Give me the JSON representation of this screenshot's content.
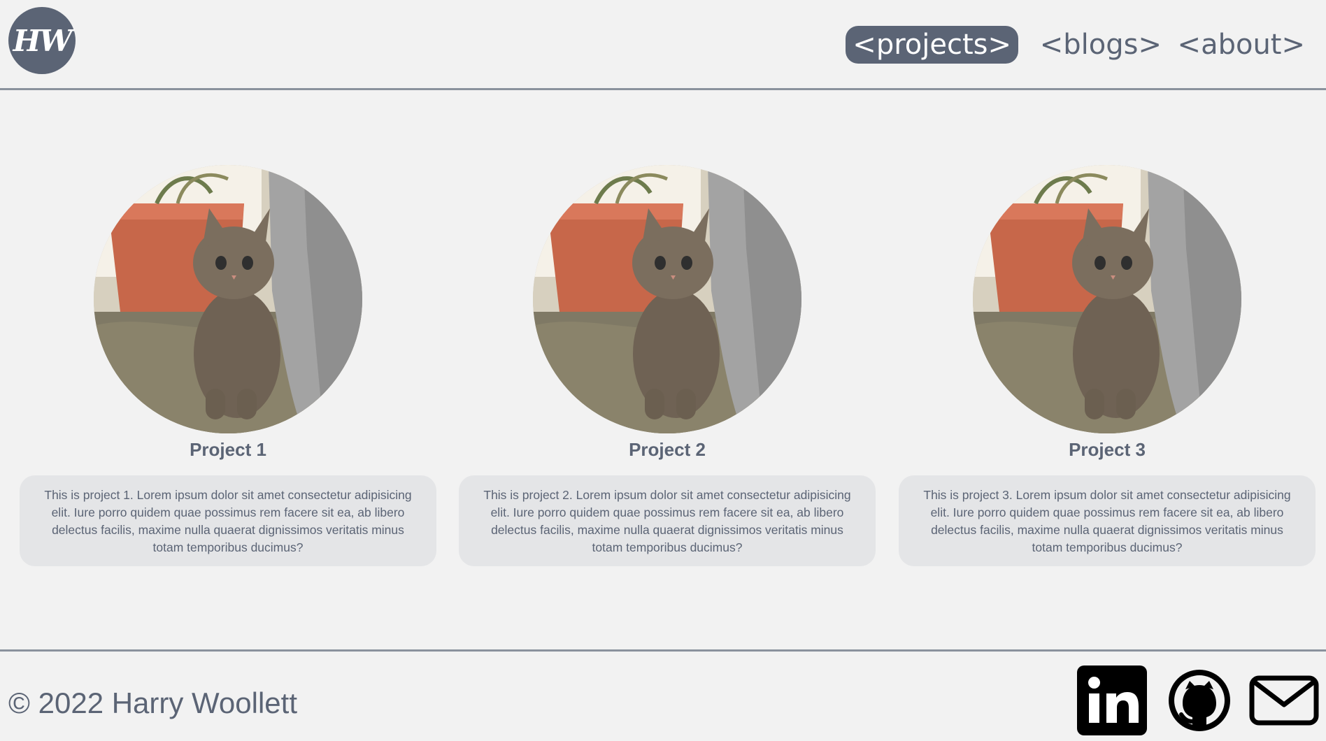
{
  "header": {
    "logo_text": "HW",
    "nav": [
      {
        "label": "<projects>",
        "active": true
      },
      {
        "label": "<blogs>",
        "active": false
      },
      {
        "label": "<about>",
        "active": false
      }
    ]
  },
  "projects": [
    {
      "title": "Project 1",
      "description": "This is project 1. Lorem ipsum dolor sit amet consectetur adipisicing elit. Iure porro quidem quae possimus rem facere sit ea, ab libero delectus facilis, maxime nulla quaerat dignissimos veritatis minus totam temporibus ducimus?"
    },
    {
      "title": "Project 2",
      "description": "This is project 2. Lorem ipsum dolor sit amet consectetur adipisicing elit. Iure porro quidem quae possimus rem facere sit ea, ab libero delectus facilis, maxime nulla quaerat dignissimos veritatis minus totam temporibus ducimus?"
    },
    {
      "title": "Project 3",
      "description": "This is project 3. Lorem ipsum dolor sit amet consectetur adipisicing elit. Iure porro quidem quae possimus rem facere sit ea, ab libero delectus facilis, maxime nulla quaerat dignissimos veritatis minus totam temporibus ducimus?"
    }
  ],
  "footer": {
    "copyright": "© 2022 Harry Woollett",
    "social_icons": [
      "linkedin-icon",
      "github-icon",
      "mail-icon"
    ]
  },
  "colors": {
    "accent": "#5b6475",
    "background": "#f2f2f2",
    "card_background": "#e4e5e7"
  }
}
